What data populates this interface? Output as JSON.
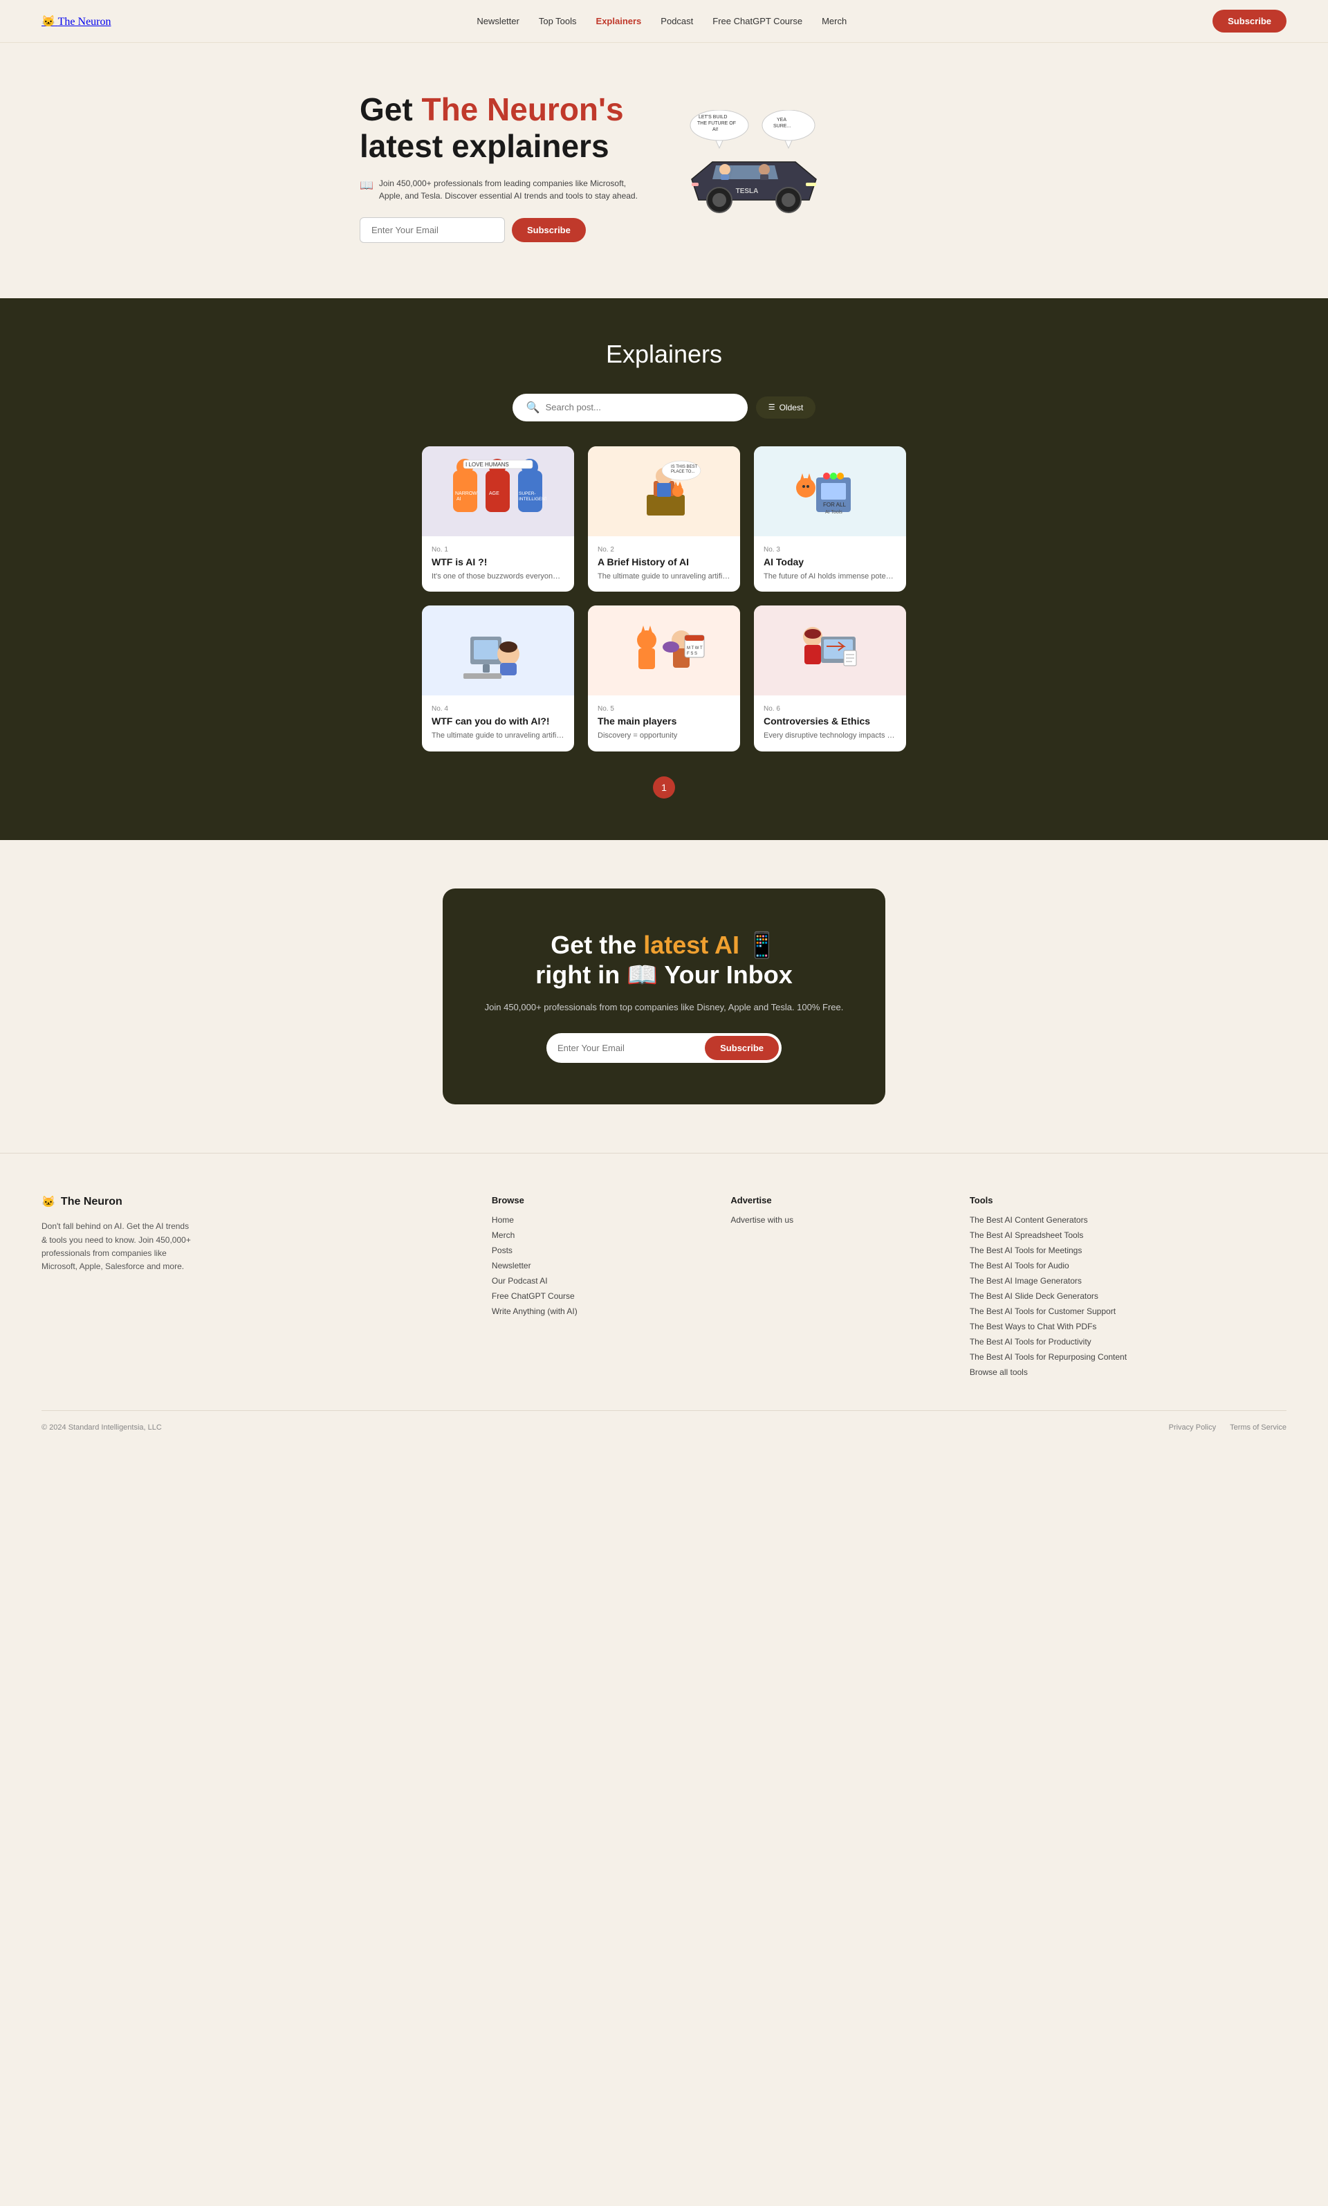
{
  "nav": {
    "logo_icon": "🐱",
    "logo_text": "The Neuron",
    "links": [
      {
        "label": "Newsletter",
        "active": false
      },
      {
        "label": "Top Tools",
        "active": false
      },
      {
        "label": "Explainers",
        "active": true
      },
      {
        "label": "Podcast",
        "active": false
      },
      {
        "label": "Free ChatGPT Course",
        "active": false
      },
      {
        "label": "Merch",
        "active": false
      }
    ],
    "subscribe_label": "Subscribe"
  },
  "hero": {
    "title_prefix": "Get ",
    "title_brand": "The Neuron's",
    "title_suffix": "latest explainers",
    "sub_icon": "📖",
    "sub_text": "Join 450,000+ professionals from leading companies like Microsoft, Apple, and Tesla. Discover essential AI trends and tools to stay ahead.",
    "email_placeholder": "Enter Your Email",
    "subscribe_label": "Subscribe"
  },
  "explainers": {
    "title": "Explainers",
    "search_placeholder": "Search post...",
    "filter_label": "Oldest",
    "cards": [
      {
        "num": "No. 1",
        "title": "WTF is AI ?!",
        "desc": "It's one of those buzzwords everyone, from your boss...",
        "emoji": "🦸"
      },
      {
        "num": "No. 2",
        "title": "A Brief History of AI",
        "desc": "The ultimate guide to unraveling artificial intelligence...",
        "emoji": "💼"
      },
      {
        "num": "No. 3",
        "title": "AI Today",
        "desc": "The future of AI holds immense potential",
        "emoji": "🤖"
      },
      {
        "num": "No. 4",
        "title": "WTF can you do with AI?!",
        "desc": "The ultimate guide to unraveling artificial intelligence...",
        "emoji": "💻"
      },
      {
        "num": "No. 5",
        "title": "The main players",
        "desc": "Discovery = opportunity",
        "emoji": "🏆"
      },
      {
        "num": "No. 6",
        "title": "Controversies & Ethics",
        "desc": "Every disruptive technology impacts society in both...",
        "emoji": "⚖️"
      }
    ],
    "page_num": "1"
  },
  "cta": {
    "title_prefix": "Get the ",
    "title_highlight": "latest AI",
    "title_middle": " 📱",
    "title_suffix": "right in 📖 Your Inbox",
    "sub_text": "Join 450,000+ professionals from top companies like Disney, Apple and Tesla. 100% Free.",
    "email_placeholder": "Enter Your Email",
    "subscribe_label": "Subscribe"
  },
  "footer": {
    "logo_icon": "🐱",
    "logo_text": "The Neuron",
    "brand_desc": "Don't fall behind on AI. Get the AI trends & tools you need to know. Join 450,000+ professionals from companies like Microsoft, Apple, Salesforce and more.",
    "browse_title": "Browse",
    "browse_links": [
      "Home",
      "Merch",
      "Posts",
      "Newsletter",
      "Our Podcast AI",
      "Free ChatGPT Course",
      "Write Anything (with AI)"
    ],
    "advertise_title": "Advertise",
    "advertise_links": [
      "Advertise with us"
    ],
    "tools_title": "Tools",
    "tools_links": [
      "The Best AI Content Generators",
      "The Best AI Spreadsheet Tools",
      "The Best AI Tools for Meetings",
      "The Best AI Tools for Audio",
      "The Best AI Image Generators",
      "The Best AI Slide Deck Generators",
      "The Best AI Tools for Customer Support",
      "The Best Ways to Chat With PDFs",
      "The Best AI Tools for Productivity",
      "The Best AI Tools for Repurposing Content",
      "Browse all tools"
    ],
    "copyright": "© 2024 Standard Intelligentsia, LLC",
    "privacy_label": "Privacy Policy",
    "terms_label": "Terms of Service"
  }
}
